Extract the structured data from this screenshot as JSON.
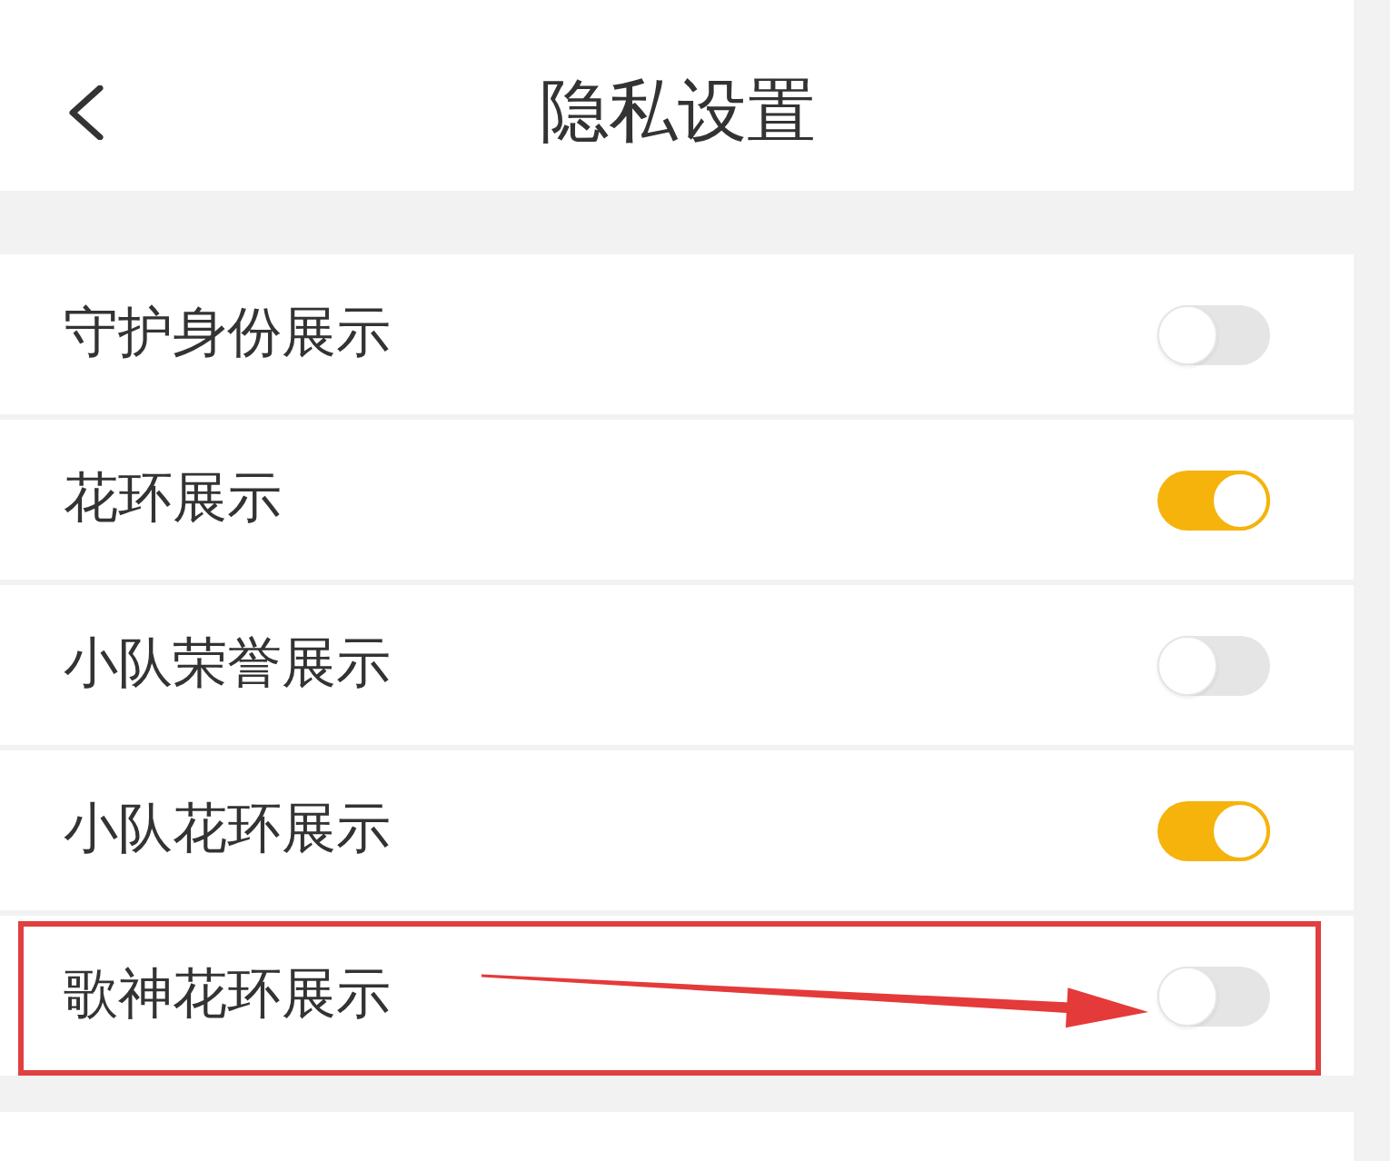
{
  "header": {
    "title": "隐私设置"
  },
  "settings": [
    {
      "label": "守护身份展示",
      "on": false,
      "highlighted": false
    },
    {
      "label": "花环展示",
      "on": true,
      "highlighted": false
    },
    {
      "label": "小队荣誉展示",
      "on": false,
      "highlighted": false
    },
    {
      "label": "小队花环展示",
      "on": true,
      "highlighted": false
    },
    {
      "label": "歌神花环展示",
      "on": false,
      "highlighted": true
    }
  ]
}
